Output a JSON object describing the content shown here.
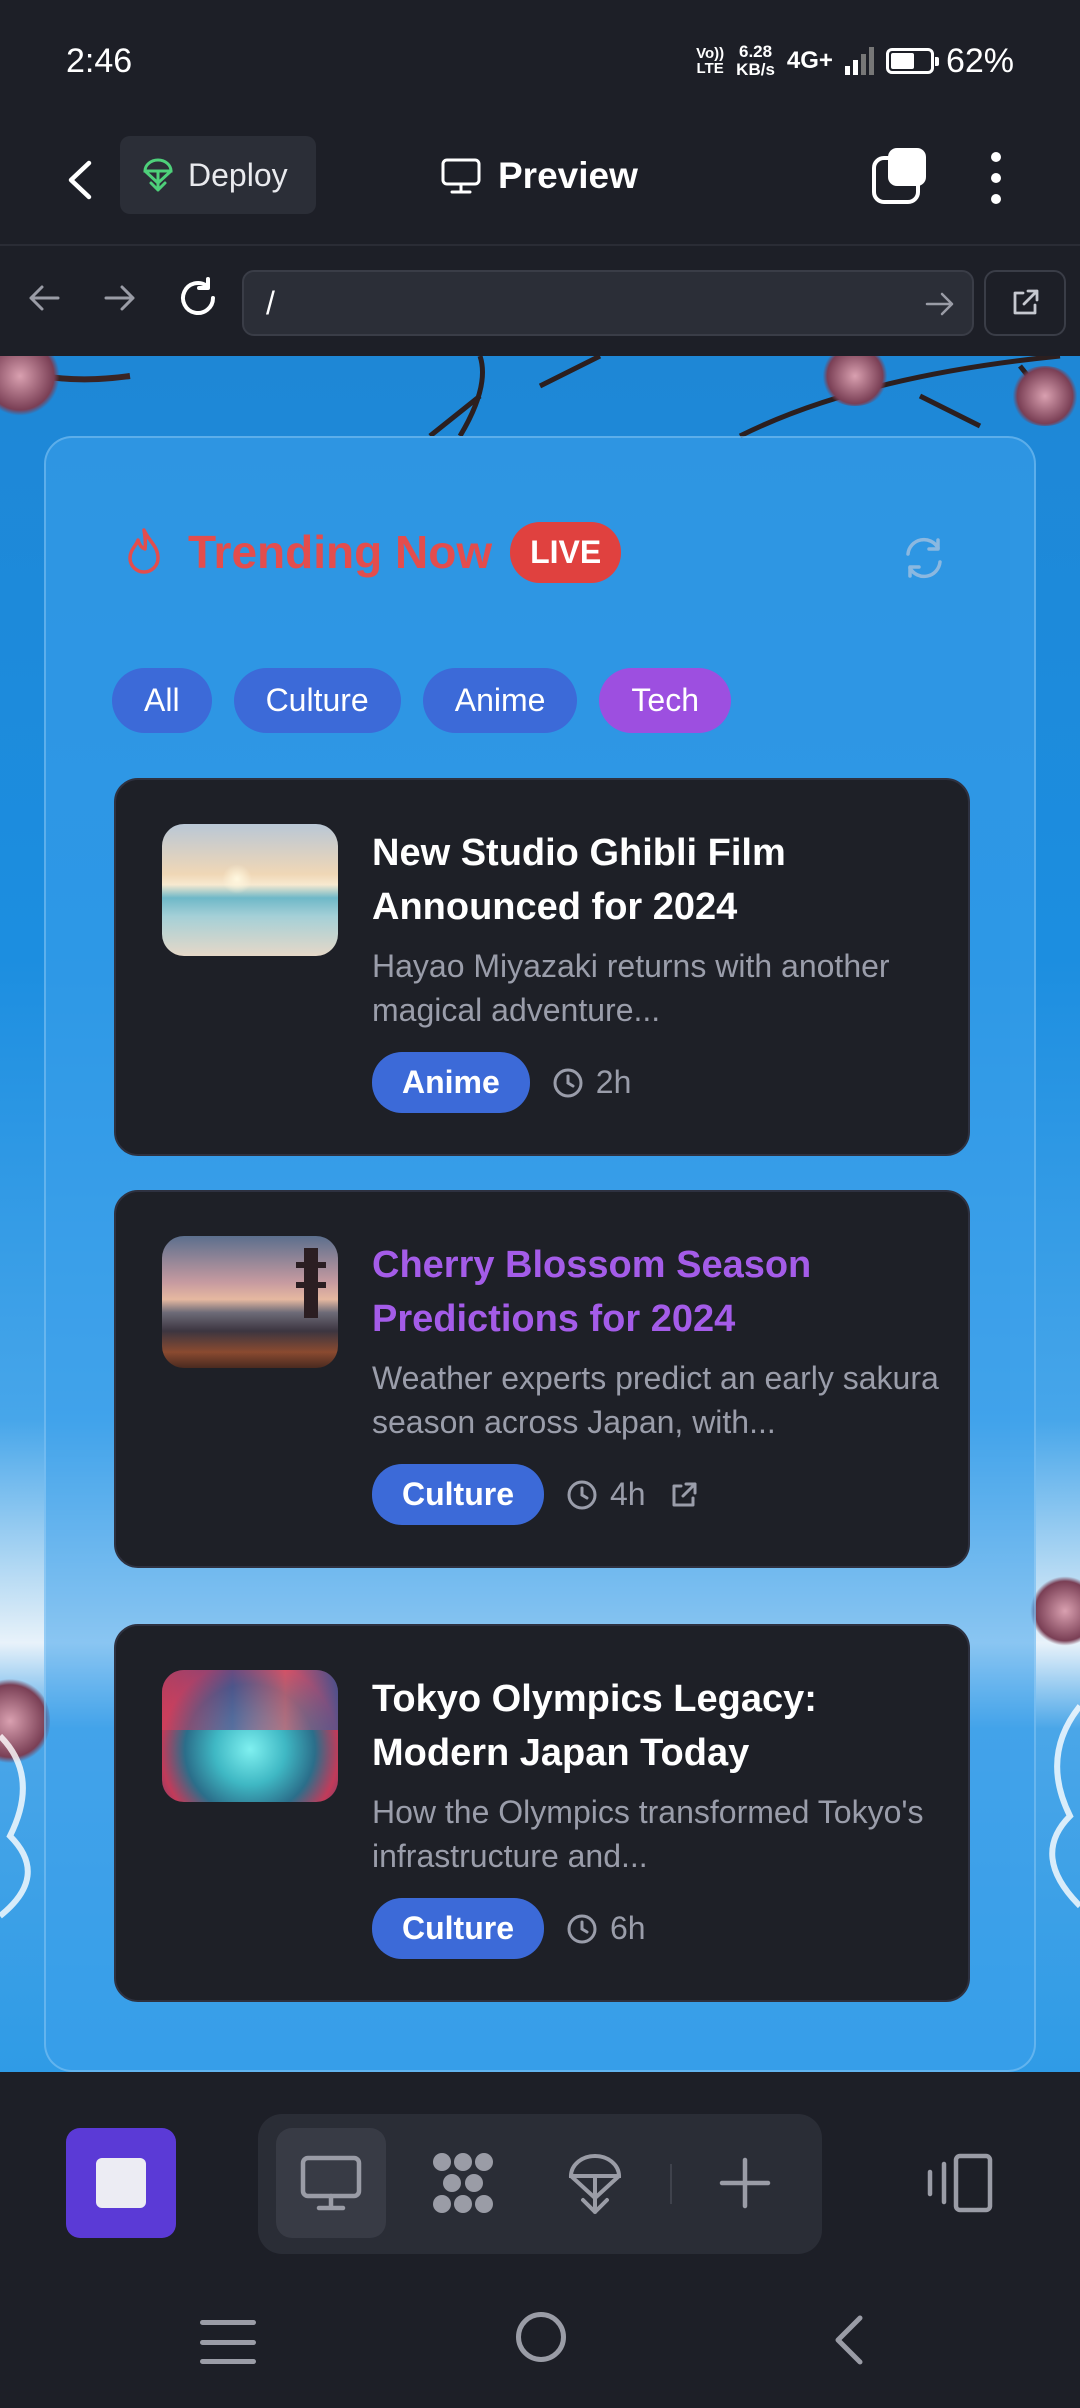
{
  "status_bar": {
    "time": "2:46",
    "volte_top": "Vo))",
    "volte_bottom": "LTE",
    "speed_value": "6.28",
    "speed_unit": "KB/s",
    "network": "4G+",
    "battery": "62%",
    "battery_level": 0.62
  },
  "header": {
    "deploy_label": "Deploy",
    "title": "Preview"
  },
  "url_bar": {
    "value": "/"
  },
  "trending": {
    "title": "Trending Now",
    "live_badge": "LIVE",
    "filters": [
      "All",
      "Culture",
      "Anime",
      "Tech"
    ],
    "active_filter": "Tech"
  },
  "articles": [
    {
      "title": "New Studio Ghibli Film Announced for 2024",
      "description": "Hayao Miyazaki returns with another magical adventure...",
      "tag": "Anime",
      "time": "2h",
      "thumbnail": "beach-sunset"
    },
    {
      "title": "Cherry Blossom Season Predictions for 2024",
      "description": "Weather experts predict an early sakura season across Japan, with...",
      "tag": "Culture",
      "time": "4h",
      "thumbnail": "pagoda-dusk",
      "highlighted": true
    },
    {
      "title": "Tokyo Olympics Legacy: Modern Japan Today",
      "description": "How the Olympics transformed Tokyo's infrastructure and...",
      "tag": "Culture",
      "time": "6h",
      "thumbnail": "city-street"
    }
  ],
  "icons": {
    "fire": "fire-icon",
    "refresh": "refresh-icon",
    "clock": "clock-icon",
    "external": "external-link-icon"
  },
  "colors": {
    "accent_red": "#e34d4d",
    "chip_blue": "#3c6ad8",
    "chip_purple": "#9d4fe0",
    "card_bg": "#1e2027",
    "app_bg": "#1d1f27"
  }
}
